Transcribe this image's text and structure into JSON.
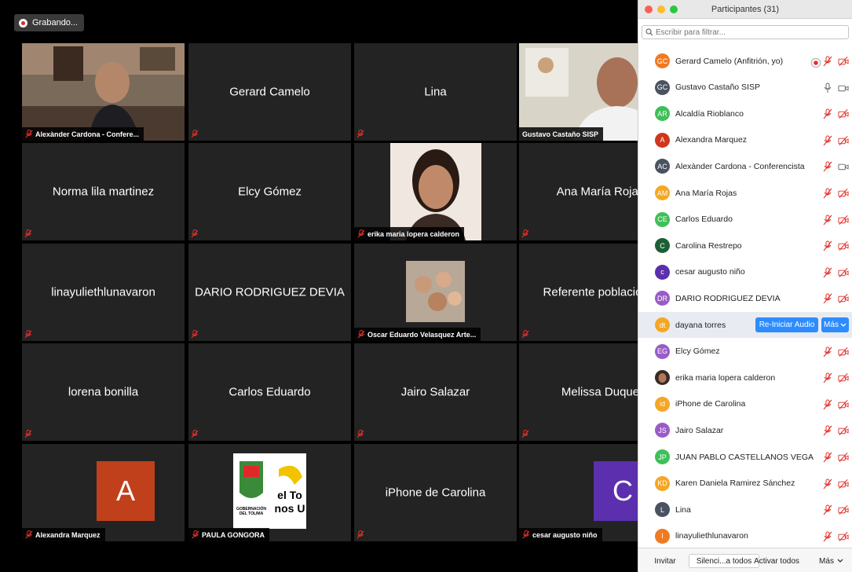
{
  "recording": {
    "label": "Grabando..."
  },
  "tiles": [
    {
      "type": "video",
      "caption": "Alexànder Cardona - Confere...",
      "photo": "man-office"
    },
    {
      "type": "name",
      "name": "Gerard Camelo"
    },
    {
      "type": "name",
      "name": "Lina"
    },
    {
      "type": "video",
      "caption": "Gustavo Castaño SISP",
      "photo": "man-speaker",
      "active": true,
      "caption_muted": false
    },
    {
      "type": "name",
      "name": "Norma lila martinez"
    },
    {
      "type": "name",
      "name": "Elcy Gómez"
    },
    {
      "type": "video",
      "caption": "erika maria lopera calderon",
      "photo": "woman-portrait"
    },
    {
      "type": "name",
      "name": "Ana María Rojas"
    },
    {
      "type": "name",
      "name": "linayuliethlunavaron"
    },
    {
      "type": "name",
      "name": "DARIO RODRIGUEZ DEVIA"
    },
    {
      "type": "video",
      "caption": "Oscar Eduardo Velasquez Arte...",
      "photo": "family"
    },
    {
      "type": "name",
      "name": "Referente poblacional"
    },
    {
      "type": "name",
      "name": "lorena bonilla"
    },
    {
      "type": "name",
      "name": "Carlos Eduardo"
    },
    {
      "type": "name",
      "name": "Jairo Salazar"
    },
    {
      "type": "name",
      "name": "Melissa Duque"
    },
    {
      "type": "avatar",
      "caption": "Alexandra Marquez",
      "letter": "A",
      "color": "#c0401c"
    },
    {
      "type": "logo",
      "caption": "PAULA GONGORA",
      "logo_text": [
        "GOBERNACIÓN",
        "DEL TOLIMA",
        "el To",
        "nos U"
      ]
    },
    {
      "type": "name",
      "name": "iPhone de Carolina"
    },
    {
      "type": "avatar",
      "caption": "cesar augusto niño",
      "letter": "C",
      "color": "#5b2fae"
    }
  ],
  "panel": {
    "title": "Participantes (31)",
    "search_placeholder": "Escribir para filtrar...",
    "participants": [
      {
        "initials": "GC",
        "name": "Gerard Camelo (Anfitrión, yo)",
        "color": "#f07a22",
        "mic": "muted",
        "video": "off",
        "recording": true
      },
      {
        "initials": "GC",
        "name": "Gustavo Castaño SISP",
        "color": "#4a5260",
        "mic": "on",
        "video": "on"
      },
      {
        "initials": "AR",
        "name": "Alcaldía Rioblanco",
        "color": "#3fbf57",
        "mic": "muted",
        "video": "off"
      },
      {
        "initials": "A",
        "name": "Alexandra Marquez",
        "color": "#d0361d",
        "mic": "muted",
        "video": "off"
      },
      {
        "initials": "AC",
        "name": "Alexànder Cardona - Conferencista",
        "color": "#4a5260",
        "mic": "muted",
        "video": "on"
      },
      {
        "initials": "AM",
        "name": "Ana María Rojas",
        "color": "#f5a623",
        "mic": "muted",
        "video": "off"
      },
      {
        "initials": "CE",
        "name": "Carlos Eduardo",
        "color": "#3fbf57",
        "mic": "muted",
        "video": "off"
      },
      {
        "initials": "C",
        "name": "Carolina Restrepo",
        "color": "#1d5f35",
        "mic": "muted",
        "video": "off"
      },
      {
        "initials": "c",
        "name": "cesar augusto niño",
        "color": "#5b2fae",
        "mic": "muted",
        "video": "off"
      },
      {
        "initials": "DR",
        "name": "DARIO RODRIGUEZ DEVIA",
        "color": "#9a5bc9",
        "mic": "muted",
        "video": "off"
      },
      {
        "initials": "dt",
        "name": "dayana torres",
        "color": "#f5a623",
        "highlight": true,
        "btn1": "Re-Iniciar Audio",
        "btn2": "Más"
      },
      {
        "initials": "EG",
        "name": "Elcy Gómez",
        "color": "#9a5bc9",
        "mic": "muted",
        "video": "off"
      },
      {
        "initials": "",
        "name": "erika maria lopera calderon",
        "color": "#b07a5a",
        "mic": "muted",
        "video": "off",
        "photo": true
      },
      {
        "initials": "id",
        "name": "iPhone de Carolina",
        "color": "#f5a623",
        "mic": "muted",
        "video": "off"
      },
      {
        "initials": "JS",
        "name": "Jairo Salazar",
        "color": "#9a5bc9",
        "mic": "muted",
        "video": "off"
      },
      {
        "initials": "JP",
        "name": "JUAN PABLO CASTELLANOS VEGA",
        "color": "#3fbf57",
        "mic": "muted",
        "video": "off"
      },
      {
        "initials": "KD",
        "name": "Karen Daniela Ramirez Sánchez",
        "color": "#f5a623",
        "mic": "muted",
        "video": "off"
      },
      {
        "initials": "L",
        "name": "Lina",
        "color": "#4a5260",
        "mic": "muted",
        "video": "off"
      },
      {
        "initials": "l",
        "name": "linayuliethlunavaron",
        "color": "#f07a22",
        "mic": "muted",
        "video": "off"
      }
    ],
    "footer": {
      "invite": "Invitar",
      "mute_all": "Silenci...a todos",
      "unmute_all": "Activar todos",
      "more": "Más"
    }
  },
  "colors": {
    "accent": "#2d8cff",
    "mute_red": "#e0302a",
    "active_border": "#b8d64a"
  }
}
